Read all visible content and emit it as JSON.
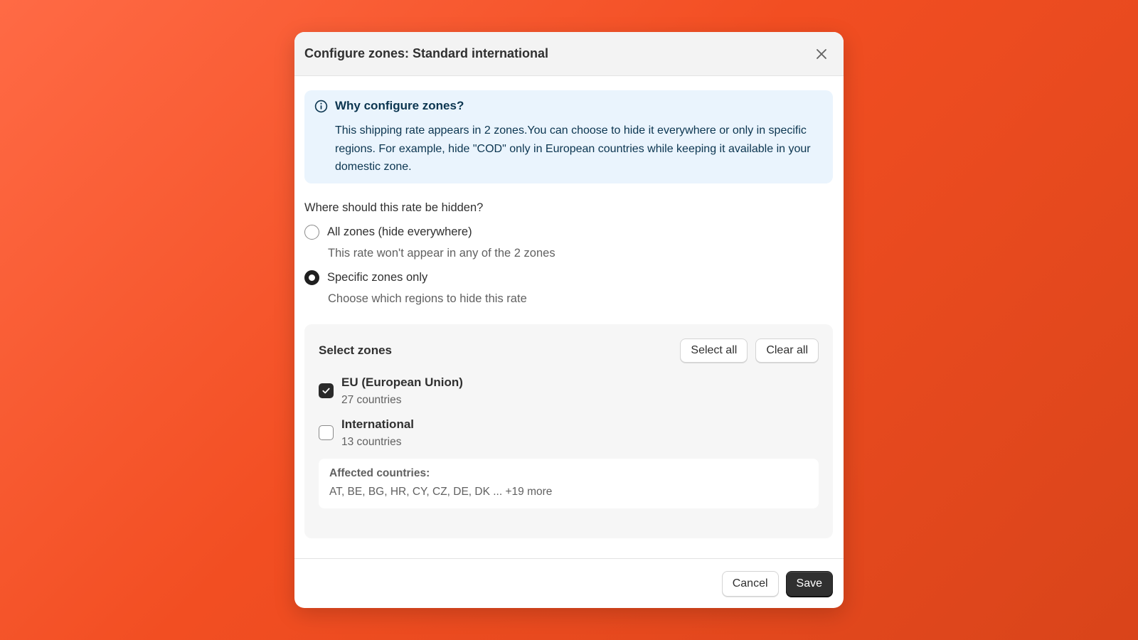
{
  "modal": {
    "title": "Configure zones: Standard international",
    "close_icon": "close-icon"
  },
  "info": {
    "icon": "info-icon",
    "title": "Why configure zones?",
    "text": "This shipping rate appears in 2 zones.You can choose to hide it everywhere or only in specific regions. For example, hide \"COD\" only in European countries while keeping it available in your domestic zone."
  },
  "question": "Where should this rate be hidden?",
  "options": [
    {
      "label": "All zones (hide everywhere)",
      "help": "This rate won't appear in any of the 2 zones",
      "selected": false
    },
    {
      "label": "Specific zones only",
      "help": "Choose which regions to hide this rate",
      "selected": true
    }
  ],
  "zones": {
    "title": "Select zones",
    "select_all_label": "Select all",
    "clear_all_label": "Clear all",
    "items": [
      {
        "name": "EU (European Union)",
        "count": "27 countries",
        "checked": true
      },
      {
        "name": "International",
        "count": "13 countries",
        "checked": false
      }
    ],
    "affected_label": "Affected countries:",
    "affected_list": "AT, BE, BG, HR, CY, CZ, DE, DK ... +19 more"
  },
  "footer": {
    "cancel_label": "Cancel",
    "save_label": "Save"
  }
}
